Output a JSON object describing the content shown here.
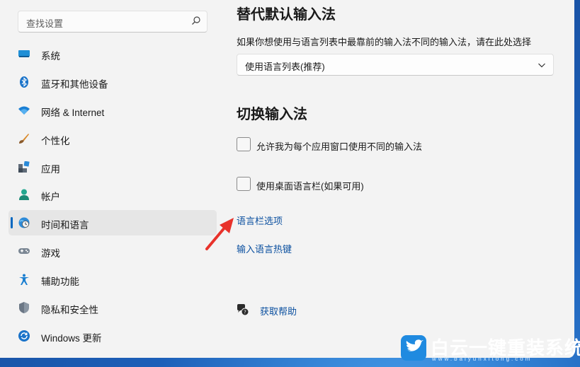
{
  "search": {
    "placeholder": "查找设置",
    "icon": "search-icon"
  },
  "sidebar": {
    "items": [
      {
        "label": "系统",
        "icon": "monitor-icon",
        "active": false
      },
      {
        "label": "蓝牙和其他设备",
        "icon": "bluetooth-icon",
        "active": false
      },
      {
        "label": "网络 & Internet",
        "icon": "wifi-icon",
        "active": false
      },
      {
        "label": "个性化",
        "icon": "brush-icon",
        "active": false
      },
      {
        "label": "应用",
        "icon": "apps-icon",
        "active": false
      },
      {
        "label": "帐户",
        "icon": "person-icon",
        "active": false
      },
      {
        "label": "时间和语言",
        "icon": "globe-clock-icon",
        "active": true
      },
      {
        "label": "游戏",
        "icon": "gamepad-icon",
        "active": false
      },
      {
        "label": "辅助功能",
        "icon": "accessibility-icon",
        "active": false
      },
      {
        "label": "隐私和安全性",
        "icon": "shield-icon",
        "active": false
      },
      {
        "label": "Windows 更新",
        "icon": "update-icon",
        "active": false
      }
    ]
  },
  "main": {
    "override_title": "替代默认输入法",
    "override_desc": "如果你想使用与语言列表中最靠前的输入法不同的输入法，请在此处选择",
    "dropdown_value": "使用语言列表(推荐)",
    "switch_title": "切换输入法",
    "checkbox_per_app": "允许我为每个应用窗口使用不同的输入法",
    "checkbox_langbar": "使用桌面语言栏(如果可用)",
    "link_langbar_options": "语言栏选项",
    "link_hotkeys": "输入语言热键",
    "help_label": "获取帮助"
  },
  "watermark": {
    "title": "白云一键重装系统",
    "url": "www.baiyunxitong.com"
  },
  "colors": {
    "accent": "#0067c0",
    "link": "#0a4f9f",
    "annotation": "#e8322b"
  }
}
